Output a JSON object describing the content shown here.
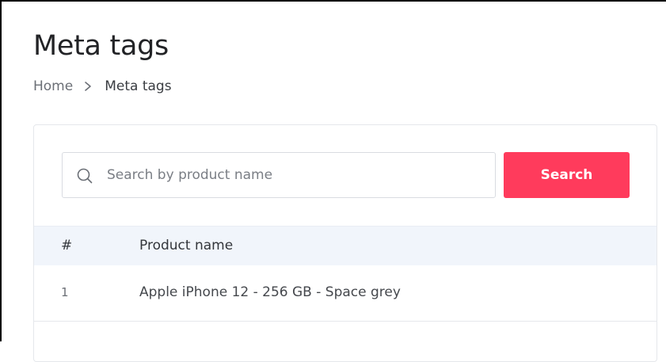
{
  "page": {
    "title": "Meta tags"
  },
  "breadcrumb": {
    "home": "Home",
    "current": "Meta tags"
  },
  "search": {
    "placeholder": "Search by product name",
    "value": "",
    "button_label": "Search"
  },
  "table": {
    "headers": [
      "#",
      "Product name"
    ],
    "rows": [
      {
        "num": "1",
        "name": "Apple iPhone 12 - 256 GB - Space grey"
      }
    ]
  },
  "icons": {
    "search": "search-icon",
    "breadcrumb_separator": "chevron-right-icon"
  },
  "colors": {
    "accent": "#ff3b5c",
    "header_bg": "#f1f5fb"
  }
}
